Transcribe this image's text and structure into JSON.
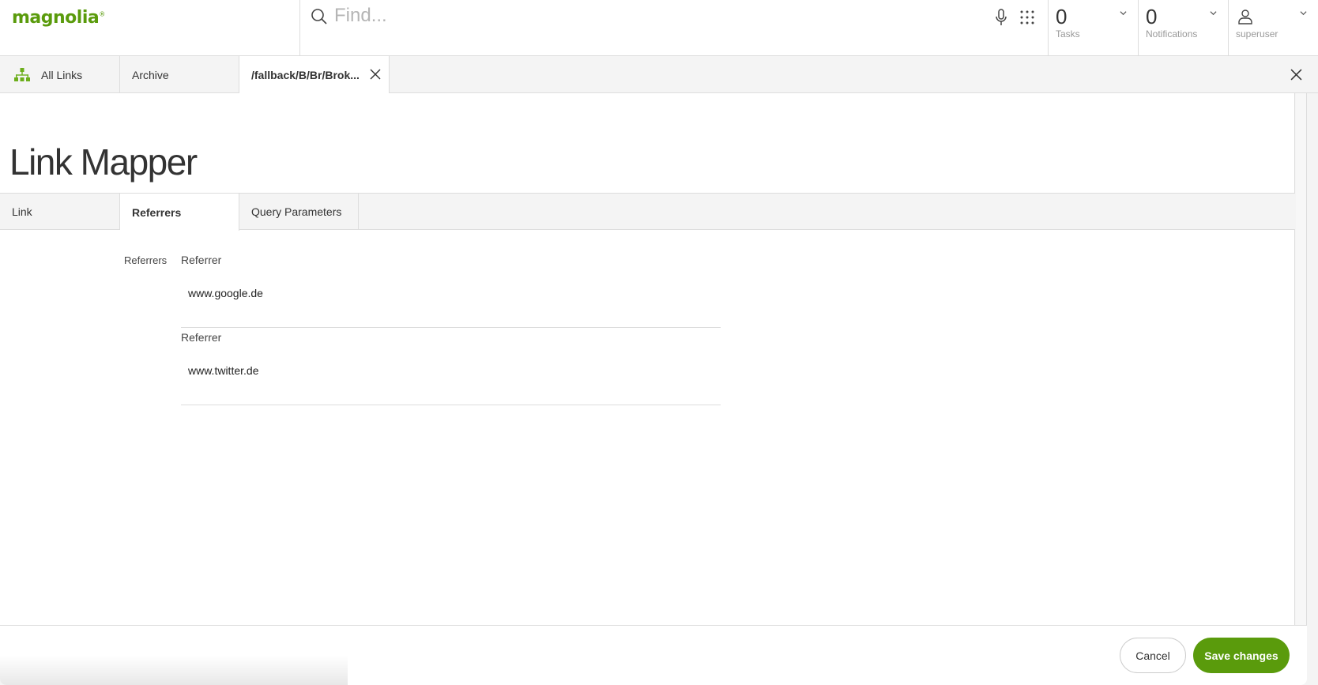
{
  "header": {
    "logo_text": "magnolia",
    "logo_mark": "®",
    "brand_color": "#5a9b0c",
    "search": {
      "placeholder": "Find...",
      "value": "",
      "icon": "search-icon"
    },
    "mic_icon": "microphone-icon",
    "apps_icon": "apps-grid-icon",
    "tasks": {
      "count": "0",
      "label": "Tasks"
    },
    "notifications": {
      "count": "0",
      "label": "Notifications"
    },
    "user": {
      "name": "superuser",
      "icon": "user-icon"
    }
  },
  "doc_tabs": [
    {
      "label": "All Links",
      "icon": "tree-icon",
      "active": false
    },
    {
      "label": "Archive",
      "active": false
    },
    {
      "label": "/fallback/B/Br/Brok...",
      "active": true,
      "closable": true
    }
  ],
  "page": {
    "title": "Link Mapper",
    "form_tabs": [
      {
        "label": "Link",
        "active": false
      },
      {
        "label": "Referrers",
        "active": true
      },
      {
        "label": "Query Parameters",
        "active": false
      }
    ],
    "group_label": "Referrers",
    "referrers": [
      {
        "label": "Referrer",
        "value": "www.google.de"
      },
      {
        "label": "Referrer",
        "value": "www.twitter.de"
      }
    ]
  },
  "footer": {
    "cancel_label": "Cancel",
    "save_label": "Save changes"
  }
}
